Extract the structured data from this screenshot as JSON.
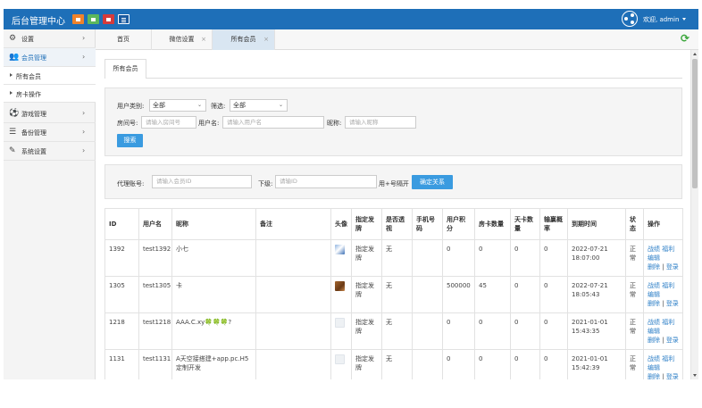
{
  "header": {
    "brand": "后台管理中心",
    "welcome": "欢迎, admin"
  },
  "sidebar": {
    "items": [
      {
        "label": "设置",
        "icon": "gears-icon"
      },
      {
        "label": "会员管理",
        "icon": "users-icon"
      },
      {
        "label": "游戏管理",
        "icon": "soccer-ball-icon"
      },
      {
        "label": "备份管理",
        "icon": "database-icon"
      },
      {
        "label": "系统设置",
        "icon": "wrench-icon"
      }
    ],
    "subitems": [
      "所有会员",
      "房卡操作"
    ]
  },
  "tabs": [
    {
      "label": "首页"
    },
    {
      "label": "微信设置"
    },
    {
      "label": "所有会员"
    }
  ],
  "page_tab": "所有会员",
  "filters": {
    "user_type_label": "用户类别:",
    "user_type_value": "全部",
    "screen_label": "筛选:",
    "screen_value": "全部",
    "room_label": "房间号:",
    "room_placeholder": "请输入房间号",
    "username_label": "用户名:",
    "username_placeholder": "请输入用户名",
    "nickname_label": "昵称:",
    "nickname_placeholder": "请输入昵称",
    "search_button": "搜索"
  },
  "agent": {
    "agent_label": "代理账号:",
    "agent_placeholder": "请输入会员ID",
    "sub_label": "下级:",
    "sub_placeholder": "请输ID",
    "hint": "用+号隔开",
    "bind_button": "确定关系"
  },
  "table": {
    "headers": [
      "ID",
      "用户名",
      "昵称",
      "备注",
      "头像",
      "指定发牌",
      "是否透视",
      "手机号码",
      "用户积分",
      "房卡数量",
      "天卡数量",
      "输赢概率",
      "到期时间",
      "状态",
      "操作"
    ],
    "rows": [
      {
        "id": "1392",
        "username": "test1392",
        "nickname": "小七",
        "note": "",
        "deal": "指定发牌",
        "xray": "无",
        "phone": "",
        "points": "0",
        "cards": "0",
        "day_cards": "0",
        "rate": "0",
        "expire": "2022-07-21 18:07:00",
        "status": "正常"
      },
      {
        "id": "1305",
        "username": "test1305",
        "nickname": "卡",
        "note": "",
        "deal": "指定发牌",
        "xray": "无",
        "phone": "",
        "points": "500000",
        "cards": "45",
        "day_cards": "0",
        "rate": "0",
        "expire": "2022-07-21 18:05:43",
        "status": "正常"
      },
      {
        "id": "1218",
        "username": "test1218",
        "nickname": "AAA.C.xy🍀🍀🍀?",
        "note": "",
        "deal": "指定发牌",
        "xray": "无",
        "phone": "",
        "points": "0",
        "cards": "0",
        "day_cards": "0",
        "rate": "0",
        "expire": "2021-01-01 15:43:35",
        "status": "正常"
      },
      {
        "id": "1131",
        "username": "test1131",
        "nickname": "A天空接搭建+app.pc.H5定制开发",
        "note": "",
        "deal": "指定发牌",
        "xray": "无",
        "phone": "",
        "points": "0",
        "cards": "0",
        "day_cards": "0",
        "rate": "0",
        "expire": "2021-01-01 15:42:39",
        "status": "正常"
      }
    ],
    "ops": {
      "battle": "战绩",
      "welfare": "福利",
      "edit": "编辑",
      "delete": "删除",
      "login": "登录"
    }
  }
}
